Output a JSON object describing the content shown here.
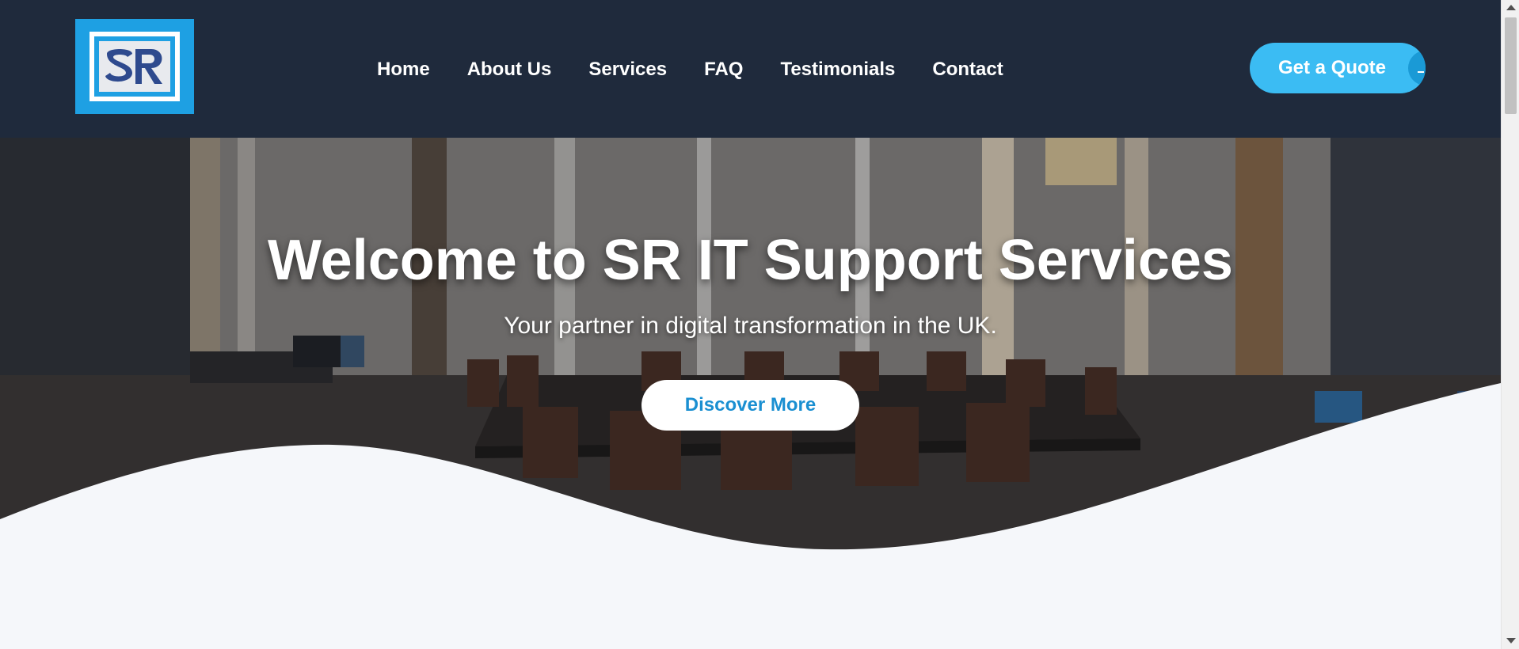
{
  "brand": {
    "logo_text": "SR",
    "logo_color": "#1ea0e3"
  },
  "nav": {
    "items": [
      {
        "label": "Home"
      },
      {
        "label": "About Us"
      },
      {
        "label": "Services"
      },
      {
        "label": "FAQ"
      },
      {
        "label": "Testimonials"
      },
      {
        "label": "Contact"
      }
    ],
    "cta_label": "Get a Quote"
  },
  "hero": {
    "title": "Welcome to SR IT Support Services",
    "subtitle": "Your partner in digital transformation in the UK.",
    "button_label": "Discover More",
    "background": "conference-room-photo"
  },
  "colors": {
    "header_bg": "#1f2a3c",
    "accent": "#3bbcf3",
    "button_text": "#1a8fd1",
    "page_bg": "#f5f7fa"
  }
}
